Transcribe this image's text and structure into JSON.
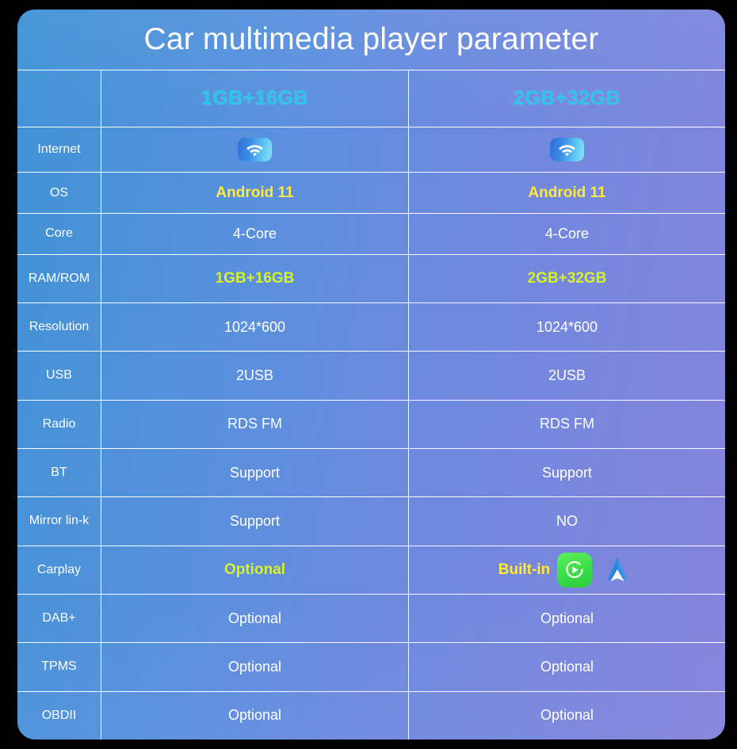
{
  "title": "Car multimedia player parameter",
  "columns": {
    "spec_label": "",
    "variant_a": "1GB+16GB",
    "variant_b": "2GB+32GB"
  },
  "colors": {
    "highlight_yellow": "#ffe93a",
    "highlight_lime": "#d6f02e",
    "header_cyan": "#2bc4e8",
    "text_white": "#ffffff",
    "carplay_green": "#3de04a",
    "android_auto_blue": "#2196f3"
  },
  "icons": {
    "internet_a": "wifi-icon",
    "internet_b": "wifi-icon",
    "carplay_b_1": "carplay-icon",
    "carplay_b_2": "android-auto-icon"
  },
  "rows": [
    {
      "label": "Internet",
      "a": "",
      "b": "",
      "a_style": "icon",
      "b_style": "icon"
    },
    {
      "label": "OS",
      "a": "Android 11",
      "b": "Android 11",
      "a_style": "yellow",
      "b_style": "yellow"
    },
    {
      "label": "Core",
      "a": "4-Core",
      "b": "4-Core",
      "a_style": "plain",
      "b_style": "plain"
    },
    {
      "label": "RAM/ROM",
      "a": "1GB+16GB",
      "b": "2GB+32GB",
      "a_style": "lime",
      "b_style": "lime"
    },
    {
      "label": "Resolution",
      "a": "1024*600",
      "b": "1024*600",
      "a_style": "plain",
      "b_style": "plain"
    },
    {
      "label": "USB",
      "a": "2USB",
      "b": "2USB",
      "a_style": "plain",
      "b_style": "plain"
    },
    {
      "label": "Radio",
      "a": "RDS FM",
      "b": "RDS FM",
      "a_style": "plain",
      "b_style": "plain"
    },
    {
      "label": "BT",
      "a": "Support",
      "b": "Support",
      "a_style": "plain",
      "b_style": "plain"
    },
    {
      "label": "Mirror lin-k",
      "a": "Support",
      "b": "NO",
      "a_style": "plain",
      "b_style": "plain"
    },
    {
      "label": "Carplay",
      "a": "Optional",
      "b": "Built-in",
      "a_style": "lime",
      "b_style": "yellow-icons"
    },
    {
      "label": "DAB+",
      "a": "Optional",
      "b": "Optional",
      "a_style": "plain",
      "b_style": "plain"
    },
    {
      "label": "TPMS",
      "a": "Optional",
      "b": "Optional",
      "a_style": "plain",
      "b_style": "plain"
    },
    {
      "label": "OBDII",
      "a": "Optional",
      "b": "Optional",
      "a_style": "plain",
      "b_style": "plain"
    }
  ]
}
